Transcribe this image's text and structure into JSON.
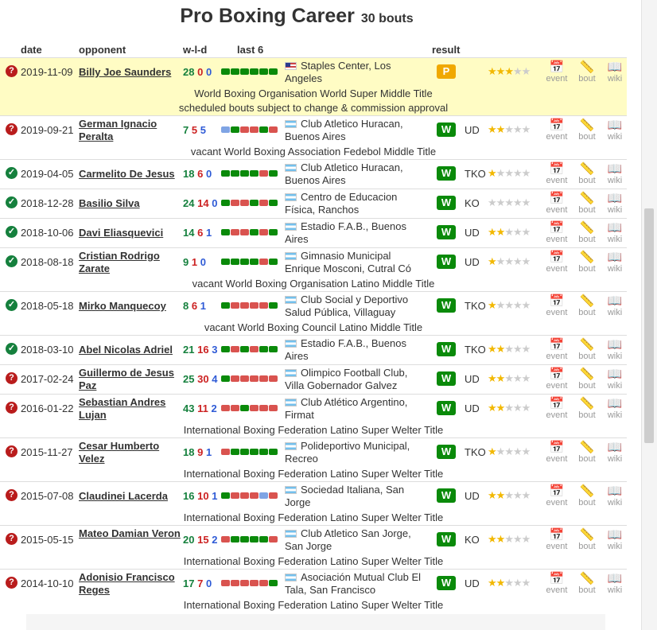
{
  "header": {
    "title": "Pro Boxing Career",
    "count": "30 bouts"
  },
  "columns": {
    "date": "date",
    "opponent": "opponent",
    "wld": "w-l-d",
    "last6": "last 6",
    "result": "result"
  },
  "links": {
    "event": "event",
    "bout": "bout",
    "wiki": "wiki"
  },
  "icons": {
    "unknown": "question-circle-icon",
    "verified": "check-circle-icon",
    "event": "calendar-clock-icon",
    "bout": "ruler-icon",
    "wiki": "book-icon"
  },
  "colors": {
    "win": "#0a8a0a",
    "loss": "#d9534f",
    "draw": "#7fa4e4",
    "pending": "#f0a800",
    "scheduled_bg": "#fffcc4"
  },
  "bouts": [
    {
      "status": "q",
      "date": "2019-11-09",
      "opponent": "Billy Joe Saunders",
      "opp_lines": 1,
      "w": "28",
      "l": "0",
      "d": "0",
      "last6": [
        "W",
        "W",
        "W",
        "W",
        "W",
        "W"
      ],
      "flag": "us",
      "venue": "Staples Center, Los Angeles",
      "result": "P",
      "method": "",
      "stars": 3,
      "sub": [
        "World Boxing Organisation World Super Middle Title",
        "scheduled bouts subject to change & commission approval"
      ],
      "scheduled": true
    },
    {
      "status": "q",
      "date": "2019-09-21",
      "opponent": "German Ignacio Peralta",
      "opp_lines": 2,
      "w": "7",
      "l": "5",
      "d": "5",
      "last6": [
        "D",
        "W",
        "L",
        "L",
        "W",
        "L"
      ],
      "flag": "ar",
      "venue": "Club Atletico Huracan, Buenos Aires",
      "result": "W",
      "method": "UD",
      "stars": 2,
      "sub": [
        "vacant World Boxing Association Fedebol Middle Title"
      ]
    },
    {
      "status": "ok",
      "date": "2019-04-05",
      "opponent": "Carmelito De Jesus",
      "opp_lines": 1,
      "w": "18",
      "l": "6",
      "d": "0",
      "last6": [
        "W",
        "W",
        "W",
        "W",
        "L",
        "W"
      ],
      "flag": "ar",
      "venue": "Club Atletico Huracan, Buenos Aires",
      "result": "W",
      "method": "TKO",
      "stars": 1,
      "sub": []
    },
    {
      "status": "ok",
      "date": "2018-12-28",
      "opponent": "Basilio Silva",
      "opp_lines": 1,
      "w": "24",
      "l": "14",
      "d": "0",
      "last6": [
        "W",
        "L",
        "L",
        "W",
        "L",
        "W"
      ],
      "flag": "ar",
      "venue": "Centro de Educacion Física, Ranchos",
      "result": "W",
      "method": "KO",
      "stars": 0,
      "sub": []
    },
    {
      "status": "ok",
      "date": "2018-10-06",
      "opponent": "Davi Eliasquevici",
      "opp_lines": 1,
      "w": "14",
      "l": "6",
      "d": "1",
      "last6": [
        "W",
        "L",
        "L",
        "W",
        "L",
        "W"
      ],
      "flag": "ar",
      "venue": "Estadio F.A.B., Buenos Aires",
      "result": "W",
      "method": "UD",
      "stars": 2,
      "sub": []
    },
    {
      "status": "ok",
      "date": "2018-08-18",
      "opponent": "Cristian Rodrigo Zarate",
      "opp_lines": 2,
      "w": "9",
      "l": "1",
      "d": "0",
      "last6": [
        "W",
        "W",
        "W",
        "W",
        "L",
        "W"
      ],
      "flag": "ar",
      "venue": "Gimnasio Municipal Enrique Mosconi, Cutral Có",
      "result": "W",
      "method": "UD",
      "stars": 1,
      "sub": [
        "vacant World Boxing Organisation Latino Middle Title"
      ]
    },
    {
      "status": "ok",
      "date": "2018-05-18",
      "opponent": "Mirko Manquecoy",
      "opp_lines": 1,
      "w": "8",
      "l": "6",
      "d": "1",
      "last6": [
        "W",
        "L",
        "L",
        "L",
        "L",
        "W"
      ],
      "flag": "ar",
      "venue": "Club Social y Deportivo Salud Pública, Villaguay",
      "result": "W",
      "method": "TKO",
      "stars": 1,
      "sub": [
        "vacant World Boxing Council Latino Middle Title"
      ]
    },
    {
      "status": "ok",
      "date": "2018-03-10",
      "opponent": "Abel Nicolas Adriel",
      "opp_lines": 1,
      "w": "21",
      "l": "16",
      "d": "3",
      "last6": [
        "W",
        "L",
        "W",
        "L",
        "W",
        "W"
      ],
      "flag": "ar",
      "venue": "Estadio F.A.B., Buenos Aires",
      "result": "W",
      "method": "TKO",
      "stars": 2,
      "sub": []
    },
    {
      "status": "q",
      "date": "2017-02-24",
      "opponent": "Guillermo de Jesus Paz",
      "opp_lines": 2,
      "w": "25",
      "l": "30",
      "d": "4",
      "last6": [
        "W",
        "L",
        "L",
        "L",
        "L",
        "L"
      ],
      "flag": "ar",
      "venue": "Olimpico Football Club, Villa Gobernador Galvez",
      "result": "W",
      "method": "UD",
      "stars": 2,
      "sub": []
    },
    {
      "status": "q",
      "date": "2016-01-22",
      "opponent": "Sebastian Andres Lujan",
      "opp_lines": 2,
      "w": "43",
      "l": "11",
      "d": "2",
      "last6": [
        "L",
        "L",
        "W",
        "L",
        "L",
        "L"
      ],
      "flag": "ar",
      "venue": "Club Atlético Argentino, Firmat",
      "result": "W",
      "method": "UD",
      "stars": 2,
      "sub": [
        "International Boxing Federation Latino Super Welter Title"
      ]
    },
    {
      "status": "q",
      "date": "2015-11-27",
      "opponent": "Cesar Humberto Velez",
      "opp_lines": 2,
      "w": "18",
      "l": "9",
      "d": "1",
      "last6": [
        "L",
        "W",
        "W",
        "W",
        "W",
        "W"
      ],
      "flag": "ar",
      "venue": "Polideportivo Municipal, Recreo",
      "result": "W",
      "method": "TKO",
      "stars": 1,
      "sub": [
        "International Boxing Federation Latino Super Welter Title"
      ]
    },
    {
      "status": "q",
      "date": "2015-07-08",
      "opponent": "Claudinei Lacerda",
      "opp_lines": 1,
      "w": "16",
      "l": "10",
      "d": "1",
      "last6": [
        "W",
        "L",
        "L",
        "L",
        "D",
        "L"
      ],
      "flag": "ar",
      "venue": "Sociedad Italiana, San Jorge",
      "result": "W",
      "method": "UD",
      "stars": 2,
      "sub": [
        "International Boxing Federation Latino Super Welter Title"
      ]
    },
    {
      "status": "q",
      "date": "2015-05-15",
      "opponent": "Mateo Damian Veron",
      "opp_lines": 2,
      "w": "20",
      "l": "15",
      "d": "2",
      "last6": [
        "L",
        "W",
        "W",
        "W",
        "W",
        "L"
      ],
      "flag": "ar",
      "venue": "Club Atletico San Jorge, San Jorge",
      "result": "W",
      "method": "KO",
      "stars": 2,
      "sub": [
        "International Boxing Federation Latino Super Welter Title"
      ]
    },
    {
      "status": "q",
      "date": "2014-10-10",
      "opponent": "Adonisio Francisco Reges",
      "opp_lines": 2,
      "w": "17",
      "l": "7",
      "d": "0",
      "last6": [
        "L",
        "L",
        "L",
        "L",
        "L",
        "W"
      ],
      "flag": "ar",
      "venue": "Asociación Mutual Club El Tala, San Francisco",
      "result": "W",
      "method": "UD",
      "stars": 2,
      "sub": [
        "International Boxing Federation Latino Super Welter Title"
      ]
    }
  ]
}
